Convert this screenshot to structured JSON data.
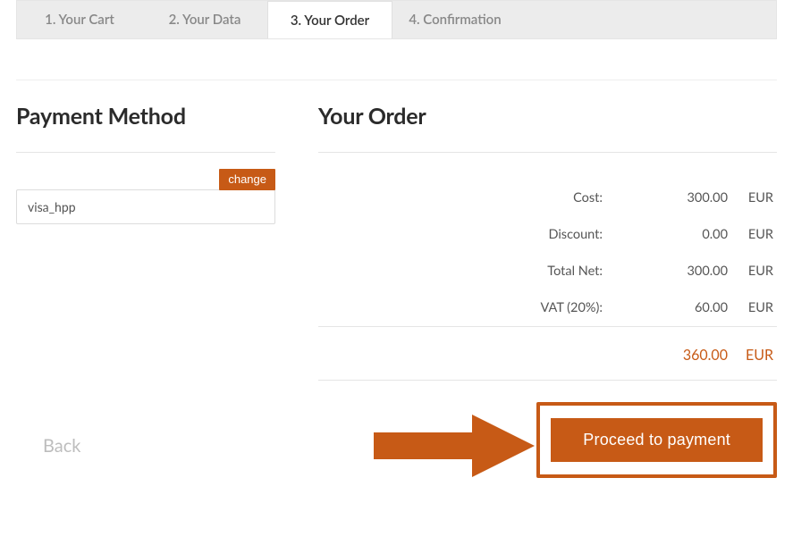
{
  "tabs": [
    {
      "label": "1. Your Cart"
    },
    {
      "label": "2. Your Data"
    },
    {
      "label": "3. Your Order"
    },
    {
      "label": "4. Confirmation"
    }
  ],
  "payment": {
    "heading": "Payment Method",
    "change_label": "change",
    "method": "visa_hpp"
  },
  "order": {
    "heading": "Your Order",
    "rows": [
      {
        "label": "Cost:",
        "value": "300.00",
        "currency": "EUR"
      },
      {
        "label": "Discount:",
        "value": "0.00",
        "currency": "EUR"
      },
      {
        "label": "Total Net:",
        "value": "300.00",
        "currency": "EUR"
      },
      {
        "label": "VAT (20%):",
        "value": "60.00",
        "currency": "EUR"
      }
    ],
    "total": {
      "value": "360.00",
      "currency": "EUR"
    }
  },
  "actions": {
    "back_label": "Back",
    "proceed_label": "Proceed to payment"
  },
  "colors": {
    "accent": "#c75a16"
  }
}
